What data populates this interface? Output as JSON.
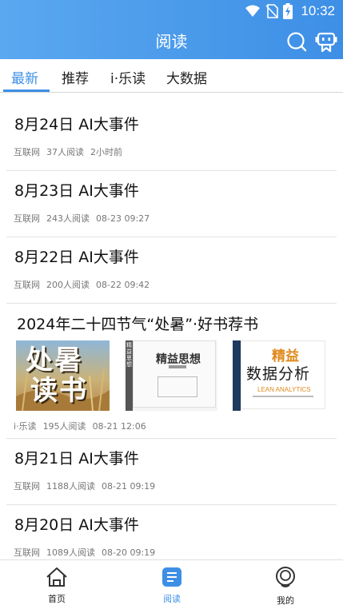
{
  "status": {
    "time": "10:32"
  },
  "header": {
    "title": "阅读"
  },
  "tabs": [
    {
      "label": "最新"
    },
    {
      "label": "推荐"
    },
    {
      "label": "i·乐读"
    },
    {
      "label": "大数据"
    }
  ],
  "articles": [
    {
      "title": "8月24日  AI大事件",
      "source": "互联网",
      "reads": "37人阅读",
      "time": "2小时前"
    },
    {
      "title": "8月23日  AI大事件",
      "source": "互联网",
      "reads": "243人阅读",
      "time": "08-23 09:27"
    },
    {
      "title": "8月22日  AI大事件",
      "source": "互联网",
      "reads": "200人阅读",
      "time": "08-22 09:42"
    },
    {
      "title": "2024年二十四节气“处暑”·好书荐书",
      "source": "i·乐读",
      "reads": "195人阅读",
      "time": "08-21 12:06",
      "images": [
        {
          "name": "处暑读书 poster",
          "line1": "处暑",
          "line2": "读书"
        },
        {
          "name": "精益思想 book",
          "text": "精益思想",
          "spine": "精益思想"
        },
        {
          "name": "精益数据分析 book",
          "text1": "精益",
          "text2": "数据分析",
          "text3": "LEAN ANALYTICS"
        }
      ]
    },
    {
      "title": "8月21日  AI大事件",
      "source": "互联网",
      "reads": "1188人阅读",
      "time": "08-21 09:19"
    },
    {
      "title": "8月20日  AI大事件",
      "source": "互联网",
      "reads": "1089人阅读",
      "time": "08-20 09:19"
    }
  ],
  "bottom_nav": [
    {
      "label": "首页",
      "icon": "home-icon"
    },
    {
      "label": "阅读",
      "icon": "reading-icon"
    },
    {
      "label": "我的",
      "icon": "profile-icon"
    }
  ],
  "colors": {
    "accent": "#3d8fe6",
    "header_start": "#5aa8f0"
  }
}
